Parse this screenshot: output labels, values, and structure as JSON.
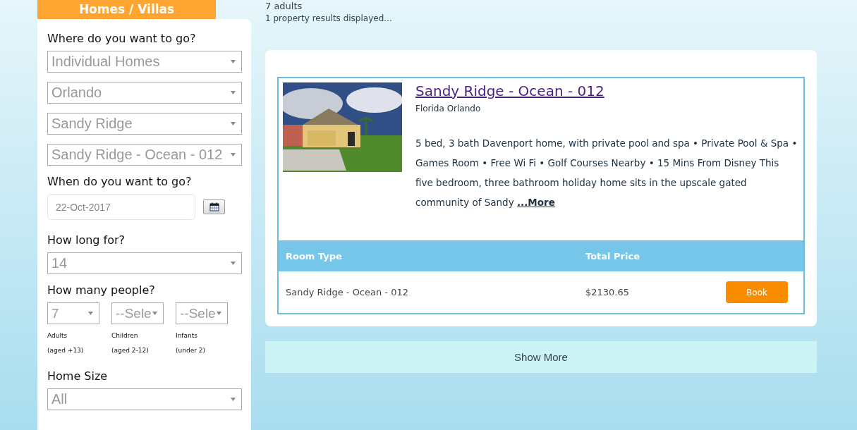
{
  "sidebar": {
    "tab": "Homes / Villas",
    "sections": [
      {
        "kind": "selects",
        "label": "Where do you want to go?",
        "selects": [
          "Individual Homes",
          "Orlando",
          "Sandy Ridge",
          "Sandy Ridge - Ocean - 012"
        ]
      },
      {
        "kind": "date",
        "label": "When do you want to go?",
        "value": "22-Oct-2017"
      },
      {
        "kind": "selects",
        "label": "How long for?",
        "selects": [
          "14"
        ]
      },
      {
        "kind": "people",
        "label": "How many people?",
        "people": [
          {
            "value": "7",
            "label": "Adults",
            "note": "(aged +13)"
          },
          {
            "value": "--Sele",
            "label": "Children",
            "note": "(aged 2-12)"
          },
          {
            "value": "--Sele",
            "label": "Infants",
            "note": "(under 2)"
          }
        ]
      },
      {
        "kind": "selects",
        "label": "Home Size",
        "selects": [
          "All"
        ]
      }
    ]
  },
  "summary": "7 adults",
  "results_count": "1 property results displayed...",
  "property": {
    "title": "Sandy Ridge - Ocean - 012",
    "location": "Florida Orlando",
    "description": "5 bed, 3 bath Davenport home, with private pool and spa • Private Pool & Spa • Games Room • Free Wi Fi • Golf Courses Nearby • 15 Mins From Disney This five bedroom, three bathroom holiday home sits in the upscale gated community of Sandy",
    "more": "...More",
    "table": {
      "columns": [
        "Room Type",
        "Total Price"
      ],
      "rows": [
        {
          "room": "Sandy Ridge - Ocean - 012",
          "price": "$2130.65",
          "action": "Book"
        }
      ]
    }
  },
  "show_more": "Show More"
}
